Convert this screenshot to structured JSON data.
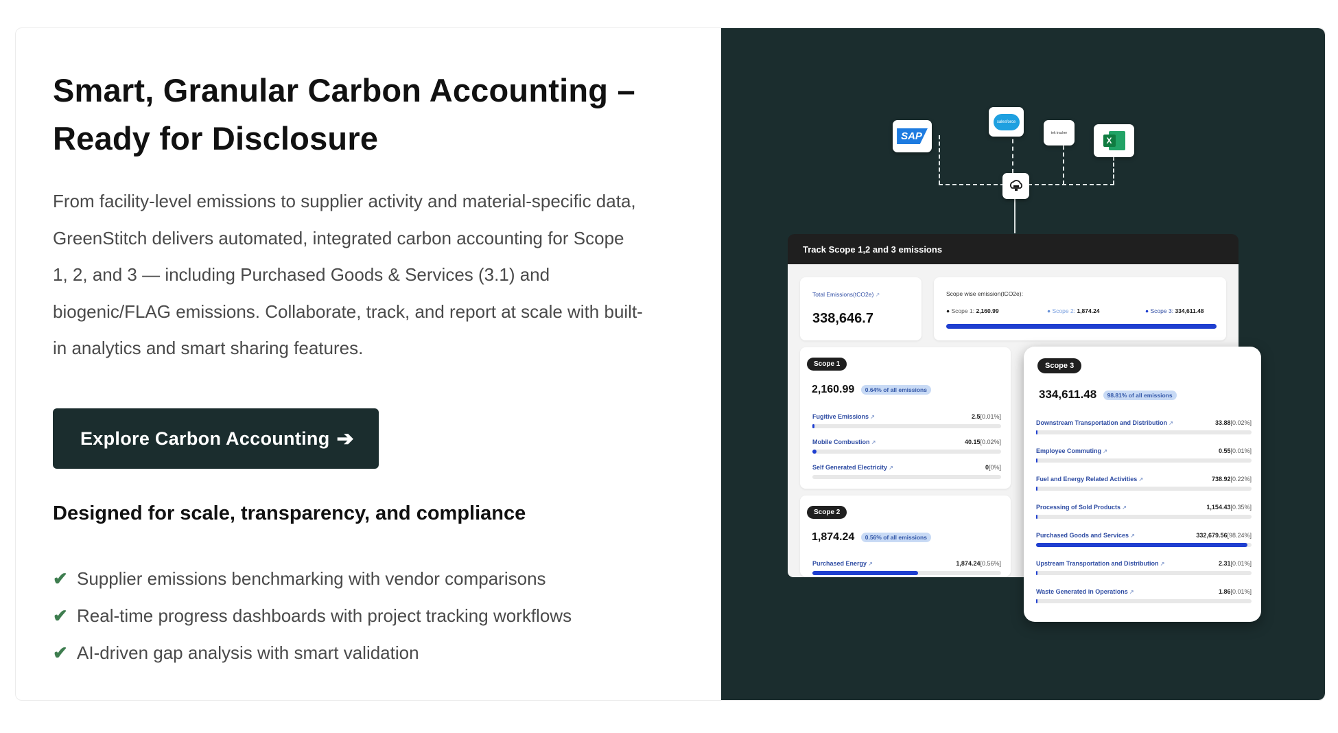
{
  "hero": {
    "title": "Smart, Granular Carbon Accounting – Ready for Disclosure",
    "description": "From facility-level emissions to supplier activity and material-specific data, GreenStitch delivers automated, integrated carbon accounting for Scope 1, 2, and 3 — including Purchased Goods & Services (3.1) and biogenic/FLAG emissions. Collaborate, track, and report at scale with built-in analytics and smart sharing features.",
    "cta_label": "Explore Carbon Accounting",
    "cta_arrow": "➔",
    "subhead": "Designed for scale, transparency, and compliance",
    "check_glyph": "✔",
    "features": [
      "Supplier emissions benchmarking with vendor comparisons",
      "Real-time progress dashboards with project tracking workflows",
      "AI-driven gap analysis with smart validation"
    ]
  },
  "integrations": {
    "sap": "SAP",
    "salesforce": "salesforce",
    "tiny_logo": "tek tracker",
    "excel": "X"
  },
  "dashboard": {
    "title": "Track Scope 1,2 and 3 emissions",
    "total_label": "Total Emissions(tCO2e)",
    "total_value": "338,646.7",
    "scopewise_label": "Scope wise emission(tCO2e):",
    "scopewise": [
      {
        "label": "Scope 1:",
        "value": "2,160.99",
        "color": "#1f1f1f"
      },
      {
        "label": "Scope 2:",
        "value": "1,874.24",
        "color": "#6a93d8"
      },
      {
        "label": "Scope 3:",
        "value": "334,611.48",
        "color": "#1f3fd0"
      }
    ],
    "scope1": {
      "pill": "Scope 1",
      "value": "2,160.99",
      "badge": "0.64% of all emissions",
      "rows": [
        {
          "label": "Fugitive Emissions",
          "value": "2.5",
          "pct": "[0.01%]",
          "fill": 0.01
        },
        {
          "label": "Mobile Combustion",
          "value": "40.15",
          "pct": "[0.02%]",
          "fill": 0.02
        },
        {
          "label": "Self Generated Electricity",
          "value": "0",
          "pct": "[0%]",
          "fill": 0
        }
      ]
    },
    "scope2": {
      "pill": "Scope 2",
      "value": "1,874.24",
      "badge": "0.56% of all emissions",
      "rows": [
        {
          "label": "Purchased Energy",
          "value": "1,874.24",
          "pct": "[0.56%]",
          "fill": 0.56
        }
      ]
    },
    "scope3": {
      "pill": "Scope 3",
      "value": "334,611.48",
      "badge": "98.81% of all emissions",
      "rows": [
        {
          "label": "Downstream Transportation and Distribution",
          "value": "33.88",
          "pct": "[0.02%]",
          "fill": 0.0002
        },
        {
          "label": "Employee Commuting",
          "value": "0.55",
          "pct": "[0.01%]",
          "fill": 0.0001
        },
        {
          "label": "Fuel and Energy Related Activities",
          "value": "738.92",
          "pct": "[0.22%]",
          "fill": 0.0022
        },
        {
          "label": "Processing of Sold Products",
          "value": "1,154.43",
          "pct": "[0.35%]",
          "fill": 0.0035
        },
        {
          "label": "Purchased Goods and Services",
          "value": "332,679.56",
          "pct": "[98.24%]",
          "fill": 0.9824
        },
        {
          "label": "Upstream Transportation and Distribution",
          "value": "2.31",
          "pct": "[0.01%]",
          "fill": 0.0001
        },
        {
          "label": "Waste Generated in Operations",
          "value": "1.86",
          "pct": "[0.01%]",
          "fill": 0.0001
        }
      ]
    }
  }
}
